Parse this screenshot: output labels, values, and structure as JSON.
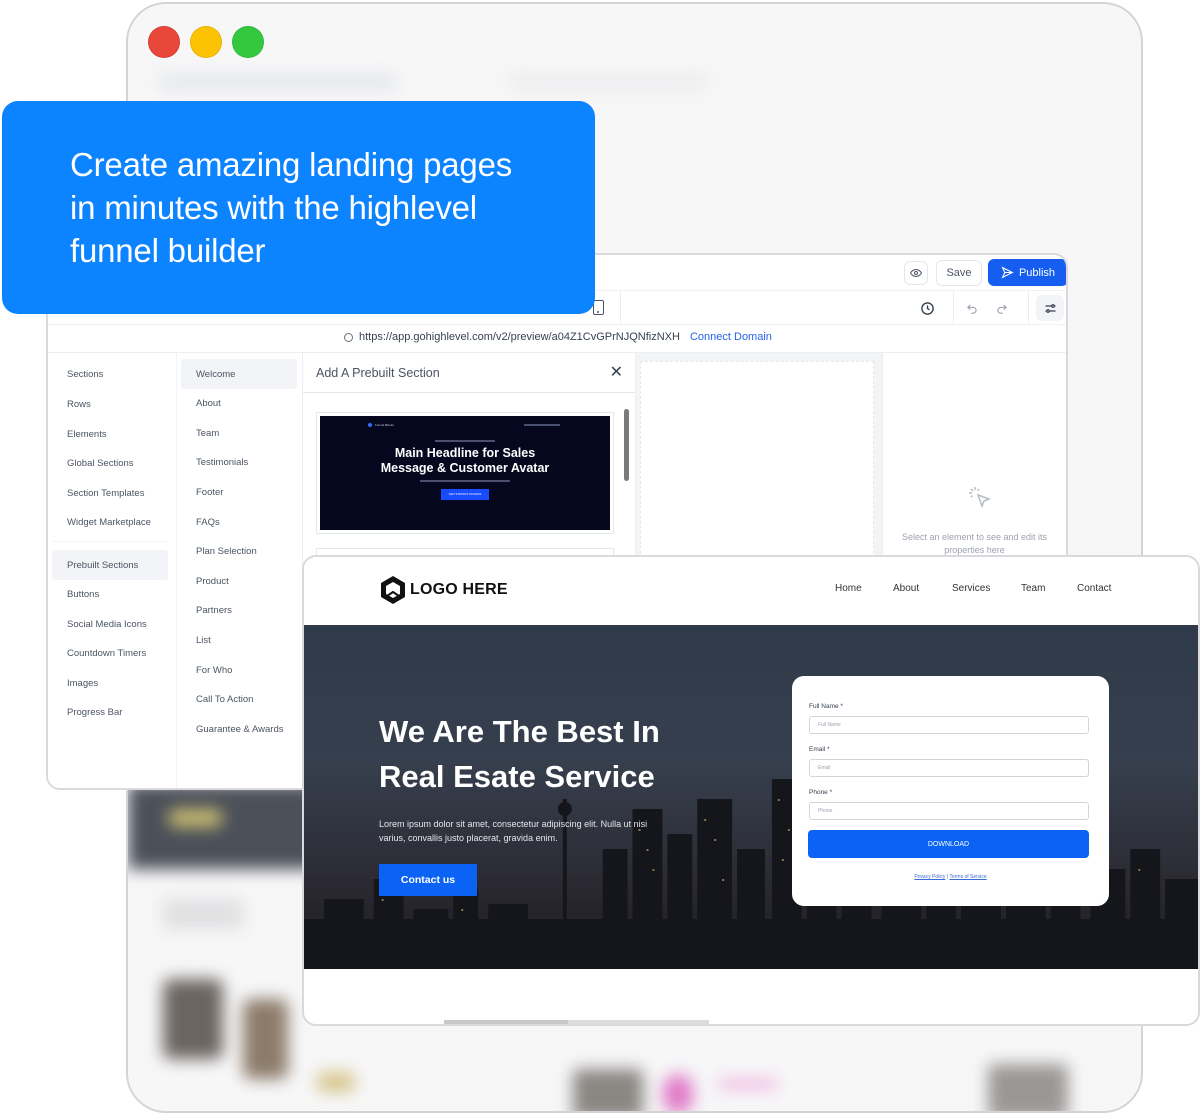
{
  "caption": {
    "lines": [
      "Create amazing landing pages",
      "in minutes with the highlevel",
      "funnel builder"
    ]
  },
  "window_controls": {
    "close_color": "#e8473a",
    "minimize_color": "#fcc204",
    "maximize_color": "#34c83f"
  },
  "editor": {
    "topbar": {
      "preview_icon": "eye-icon",
      "save_label": "Save",
      "publish_label": "Publish",
      "publish_icon": "send-icon",
      "accent_color": "#155eef"
    },
    "toolbar": {
      "device_icon": "mobile-icon",
      "history_icon": "history-icon",
      "undo_icon": "undo-icon",
      "redo_icon": "redo-icon",
      "settings_icon": "sliders-icon"
    },
    "url": {
      "value": "https://app.gohighlevel.com/v2/preview/a04Z1CvGPrNJQNfizNXH",
      "connect_label": "Connect Domain"
    },
    "sidebar": {
      "items": [
        {
          "label": "Sections",
          "active": false
        },
        {
          "label": "Rows",
          "active": false
        },
        {
          "label": "Elements",
          "active": false
        },
        {
          "label": "Global Sections",
          "active": false
        },
        {
          "label": "Section Templates",
          "active": false
        },
        {
          "label": "Widget Marketplace",
          "active": false
        },
        {
          "label": "Prebuilt Sections",
          "active": true
        },
        {
          "label": "Buttons",
          "active": false
        },
        {
          "label": "Social Media Icons",
          "active": false
        },
        {
          "label": "Countdown Timers",
          "active": false
        },
        {
          "label": "Images",
          "active": false
        },
        {
          "label": "Progress Bar",
          "active": false
        }
      ]
    },
    "categories": {
      "items": [
        {
          "label": "Welcome",
          "active": true
        },
        {
          "label": "About",
          "active": false
        },
        {
          "label": "Team",
          "active": false
        },
        {
          "label": "Testimonials",
          "active": false
        },
        {
          "label": "Footer",
          "active": false
        },
        {
          "label": "FAQs",
          "active": false
        },
        {
          "label": "Plan Selection",
          "active": false
        },
        {
          "label": "Product",
          "active": false
        },
        {
          "label": "Partners",
          "active": false
        },
        {
          "label": "List",
          "active": false
        },
        {
          "label": "For Who",
          "active": false
        },
        {
          "label": "Call To Action",
          "active": false
        },
        {
          "label": "Guarantee & Awards",
          "active": false
        }
      ]
    },
    "prebuilt_panel": {
      "title": "Add A Prebuilt Section",
      "close_icon": "close-icon",
      "thumbnail": {
        "brand": "Funnel Blocks",
        "headline_line1": "Main Headline for Sales",
        "headline_line2": "Message & Customer Avatar",
        "button_label": "GET INSTANT ACCESS"
      }
    },
    "properties": {
      "empty_icon": "cursor-click-icon",
      "empty_text": "Select an element to see and edit its properties here"
    }
  },
  "landing": {
    "logo_text": "LOGO HERE",
    "nav": [
      "Home",
      "About",
      "Services",
      "Team",
      "Contact"
    ],
    "hero": {
      "title_line1": "We Are The Best In",
      "title_line2": "Real Esate Service",
      "text": "Lorem ipsum dolor sit amet, consectetur adipiscing elit. Nulla ut nisi varius, convallis justo placerat, gravida enim.",
      "cta_label": "Contact us"
    },
    "form": {
      "fields": [
        {
          "label": "Full Name *",
          "placeholder": "Full Name"
        },
        {
          "label": "Email *",
          "placeholder": "Email"
        },
        {
          "label": "Phone *",
          "placeholder": "Phone"
        }
      ],
      "submit_label": "DOWNLOAD",
      "privacy_label": "Privacy Policy",
      "separator": "|",
      "terms_label": "Terms of Service"
    },
    "accent_color": "#0b63f6"
  }
}
